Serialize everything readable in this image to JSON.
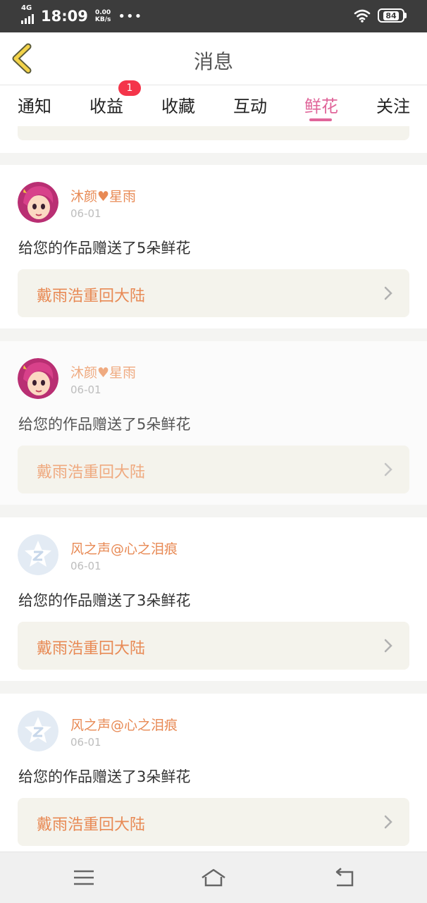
{
  "status_bar": {
    "network": "4G",
    "time": "18:09",
    "speed_value": "0.00",
    "speed_unit": "KB/s",
    "more": "•••",
    "battery": "84",
    "icons": [
      "signal-icon",
      "wifi-icon",
      "battery-icon"
    ]
  },
  "header": {
    "title": "消息",
    "back_icon": "back-chevron-icon"
  },
  "tabs": [
    {
      "label": "通知"
    },
    {
      "label": "收益",
      "badge": "1"
    },
    {
      "label": "收藏"
    },
    {
      "label": "互动"
    },
    {
      "label": "鲜花",
      "active": true
    },
    {
      "label": "关注"
    }
  ],
  "messages": [
    {
      "user": "沐颜♥星雨",
      "date": "06-01",
      "text": "给您的作品赠送了5朵鲜花",
      "work": "戴雨浩重回大陆",
      "avatar": "cartoon-girl-avatar"
    },
    {
      "user": "沐颜♥星雨",
      "date": "06-01",
      "text": "给您的作品赠送了5朵鲜花",
      "work": "戴雨浩重回大陆",
      "avatar": "cartoon-girl-avatar"
    },
    {
      "user": "风之声@心之泪痕",
      "date": "06-01",
      "text": "给您的作品赠送了3朵鲜花",
      "work": "戴雨浩重回大陆",
      "avatar": "default-z-avatar"
    },
    {
      "user": "风之声@心之泪痕",
      "date": "06-01",
      "text": "给您的作品赠送了3朵鲜花",
      "work": "戴雨浩重回大陆",
      "avatar": "default-z-avatar"
    }
  ],
  "nav": {
    "icons": [
      "menu-icon",
      "home-icon",
      "back-icon"
    ]
  },
  "colors": {
    "accent_pink": "#e0669a",
    "name_orange": "#e88a55",
    "badge_red": "#f4354a",
    "work_box": "#f4f3ec"
  }
}
